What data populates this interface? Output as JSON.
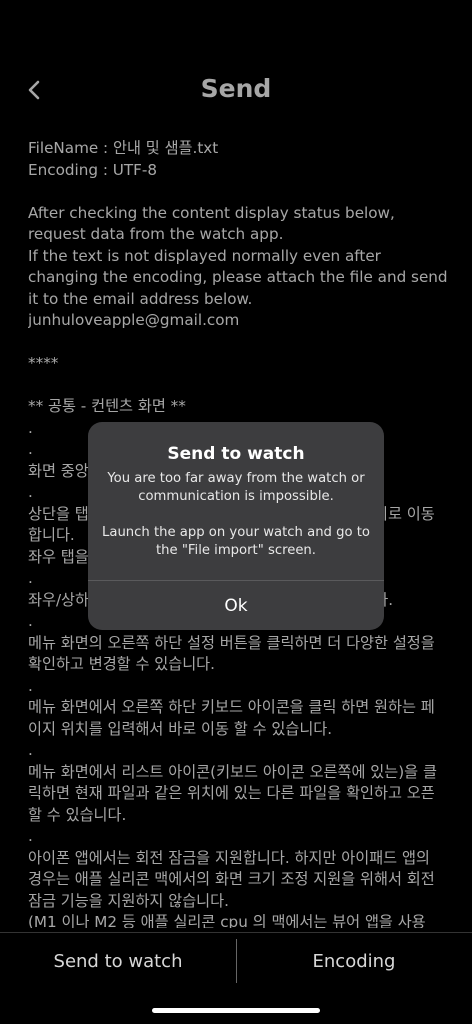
{
  "header": {
    "title": "Send"
  },
  "content": {
    "paragraphs": [
      "FileName : 안내 및 샘플.txt",
      "Encoding : UTF-8",
      "",
      "After checking the content display status below, request data from the watch app.",
      "If the text is not displayed normally even after changing the encoding, please attach the file and send it to the email address below.",
      "junhuloveapple@gmail.com",
      "",
      "****",
      "",
      "** 공통 - 컨텐츠 화면 **",
      ".",
      ".",
      "화면 중앙을 탭하면 메뉴가 나타납니다.",
      ".",
      "상단을 탭하면 이전 페이지로, 하단을 탭하면 다음 페이지로 이동합니다.",
      "좌우 탭을 이용할 수도 있습니다.",
      ".",
      "좌우/상하 넘김 방식은 설정 화면에서 변경할 수 있습니다.",
      ".",
      "메뉴 화면의 오른쪽 하단 설정 버튼을 클릭하면 더 다양한 설정을 확인하고 변경할 수 있습니다.",
      ".",
      "메뉴 화면에서 오른쪽 하단 키보드 아이콘을 클릭 하면 원하는 페이지 위치를 입력해서 바로 이동 할 수 있습니다.",
      ".",
      "메뉴 화면에서 리스트 아이콘(키보드 아이콘 오른쪽에 있는)을 클릭하면 현재 파일과 같은 위치에 있는 다른 파일을 확인하고 오픈 할 수 있습니다.",
      ".",
      "아이폰 앱에서는 회전 잠금을 지원합니다. 하지만 아이패드 앱의 경우는 애플 실리콘 맥에서의 화면 크기 조정 지원을 위해서 회전 잠금 기능을 지원하지 않습니다.",
      "(M1 이나 M2 등 애플 실리콘 cpu 의 맥에서는 뷰어 앱을 사용"
    ]
  },
  "dialog": {
    "title": "Send to watch",
    "message_1": "You are too far away from the watch or communication is impossible.",
    "message_2": "Launch the app on your watch and go to the \"File import\" screen.",
    "ok_label": "Ok"
  },
  "bottom_bar": {
    "send_label": "Send to watch",
    "encoding_label": "Encoding"
  },
  "icons": {
    "back": "chevron-left-icon"
  }
}
